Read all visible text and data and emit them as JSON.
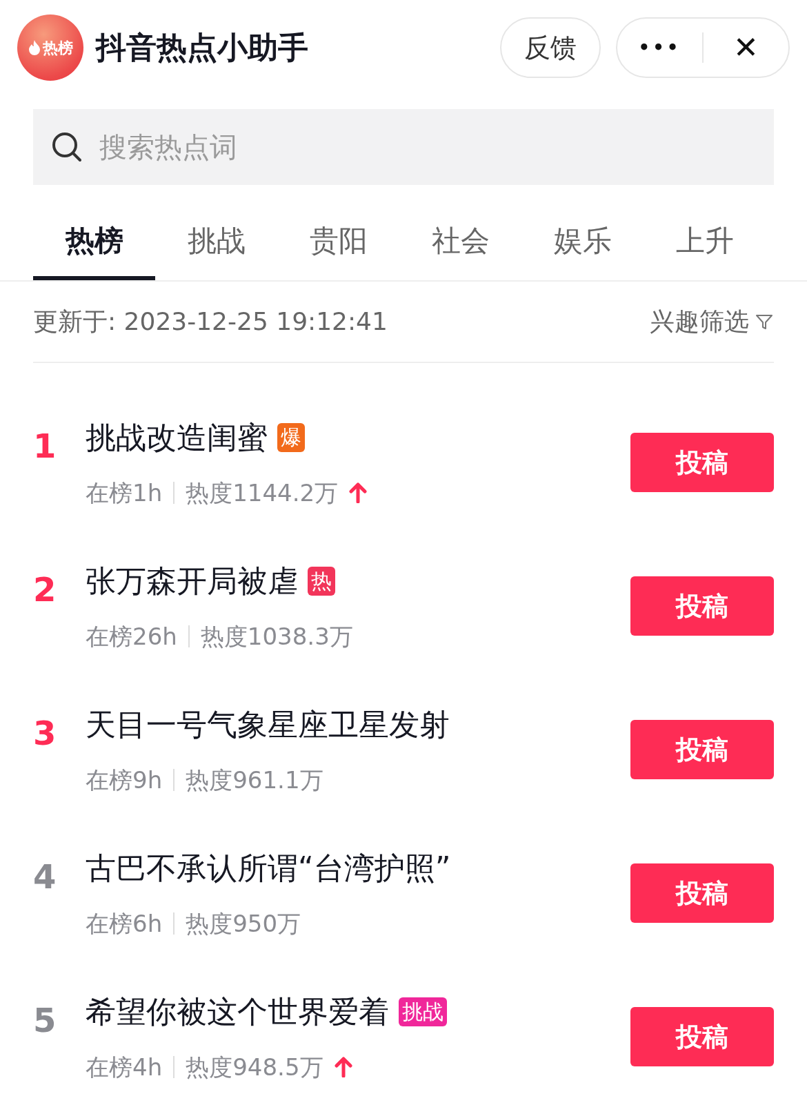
{
  "header": {
    "logo_text": "热榜",
    "title": "抖音热点小助手",
    "feedback_button": "反馈",
    "more_button": "•••",
    "close_button": "✕"
  },
  "search": {
    "placeholder": "搜索热点词"
  },
  "tabs": [
    {
      "label": "热榜",
      "selected": true
    },
    {
      "label": "挑战",
      "selected": false
    },
    {
      "label": "贵阳",
      "selected": false
    },
    {
      "label": "社会",
      "selected": false
    },
    {
      "label": "娱乐",
      "selected": false
    },
    {
      "label": "上升",
      "selected": false
    }
  ],
  "updated": "更新于: 2023-12-25 19:12:41",
  "filter": "兴趣筛选",
  "items": [
    {
      "rank": "1",
      "highlighted": true,
      "title": "挑战改造闺蜜",
      "badge": {
        "text": "爆",
        "color": "#f26a1b"
      },
      "on_list": "在榜1h",
      "heat": "热度1144.2万",
      "rising": true,
      "button": "投稿"
    },
    {
      "rank": "2",
      "highlighted": true,
      "title": "张万森开局被虐",
      "badge": {
        "text": "热",
        "color": "#f2355a"
      },
      "on_list": "在榜26h",
      "heat": "热度1038.3万",
      "rising": false,
      "button": "投稿"
    },
    {
      "rank": "3",
      "highlighted": true,
      "title": "天目一号气象星座卫星发射",
      "on_list": "在榜9h",
      "heat": "热度961.1万",
      "rising": false,
      "button": "投稿"
    },
    {
      "rank": "4",
      "highlighted": false,
      "title": "古巴不承认所谓“台湾护照”",
      "on_list": "在榜6h",
      "heat": "热度950万",
      "rising": false,
      "button": "投稿"
    },
    {
      "rank": "5",
      "highlighted": false,
      "title": "希望你被这个世界爱着",
      "badge": {
        "text": "挑战",
        "color": "#f0279a"
      },
      "on_list": "在榜4h",
      "heat": "热度948.5万",
      "rising": true,
      "button": "投稿"
    }
  ]
}
